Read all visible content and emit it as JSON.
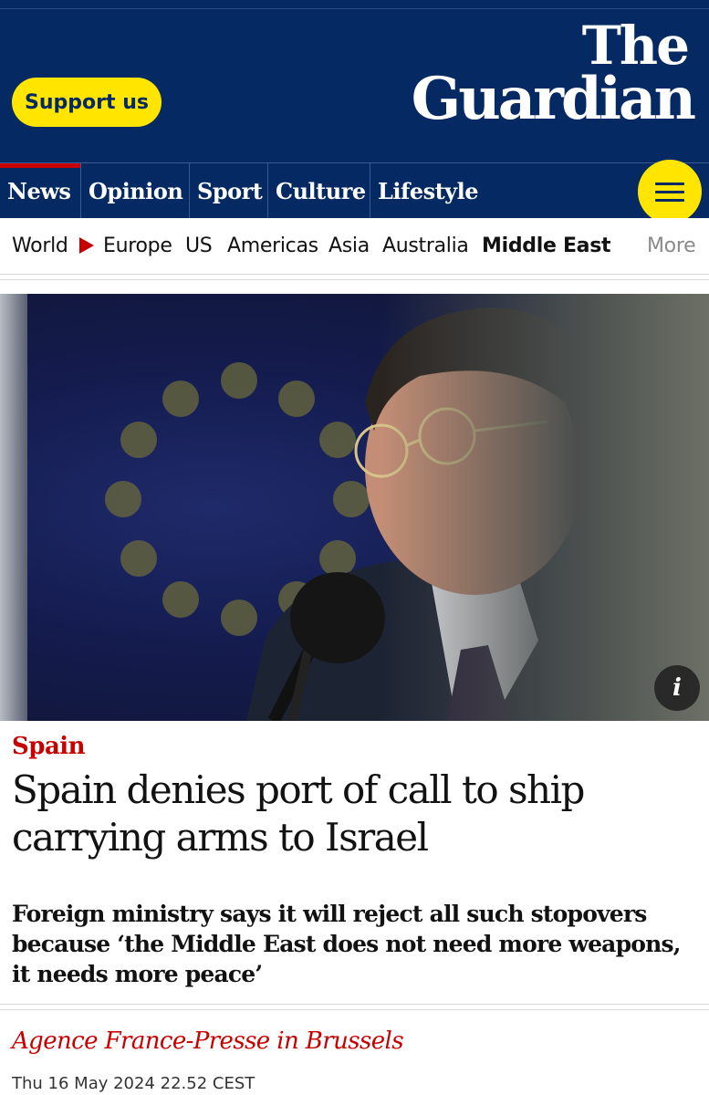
{
  "header": {
    "support_label": "Support us",
    "logo_line1": "The",
    "logo_line2": "Guardian",
    "brand_color": "#052962",
    "accent_color": "#ffe500"
  },
  "pillars": [
    "News",
    "Opinion",
    "Sport",
    "Culture",
    "Lifestyle"
  ],
  "menu_icon": "hamburger-menu-icon",
  "subnav": {
    "items": [
      "World",
      "Europe",
      "US",
      "Americas",
      "Asia",
      "Australia",
      "Middle East",
      "More"
    ],
    "current": "Middle East"
  },
  "hero": {
    "info_label": "i"
  },
  "article": {
    "section": "Spain",
    "headline": "Spain denies port of call to ship carrying arms to Israel",
    "standfirst": "Foreign ministry says it will reject all such stopovers because ‘the Middle East does not need more weapons, it needs more peace’",
    "byline": "Agence France-Presse in Brussels",
    "date": "Thu 16 May 2024 22.52 CEST",
    "accent_color": "#c70000"
  }
}
